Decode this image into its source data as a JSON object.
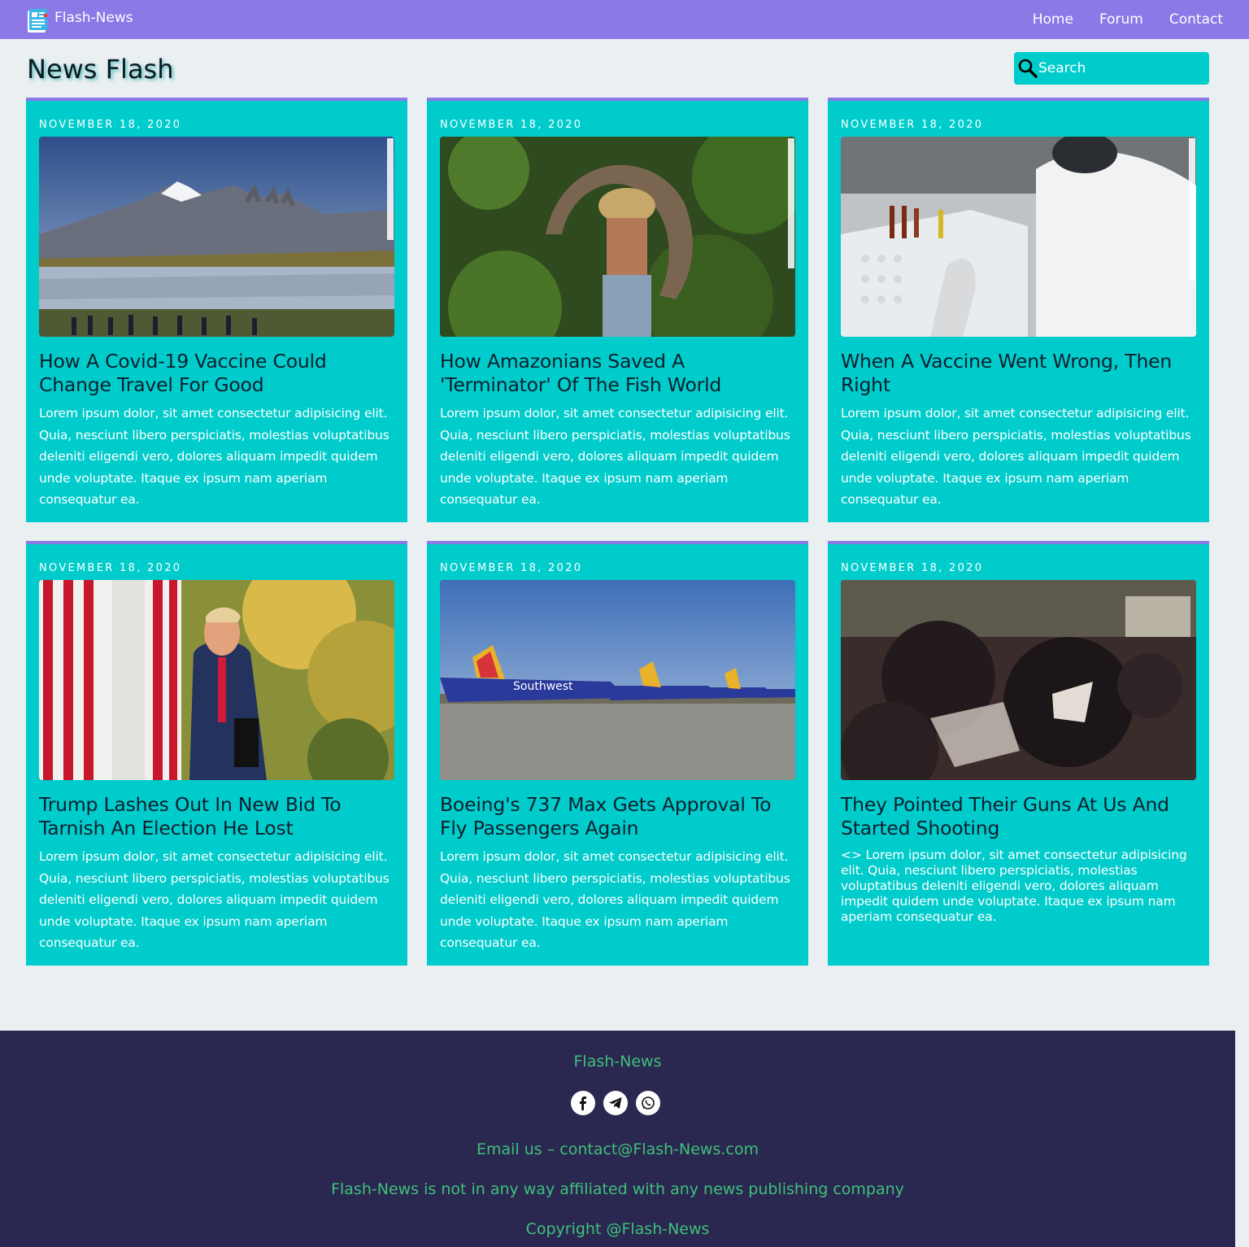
{
  "navbar": {
    "brand": "Flash-News",
    "links": [
      "Home",
      "Forum",
      "Contact"
    ]
  },
  "header": {
    "title": "News Flash",
    "search_placeholder": "Search"
  },
  "articles": [
    {
      "date": "NOVEMBER 18, 2020",
      "title": "How A Covid-19 Vaccine Could Change Travel For Good",
      "body": "Lorem ipsum dolor, sit amet consectetur adipisicing elit. Quia, nesciunt libero perspiciatis, molestias voluptatibus deleniti eligendi vero, dolores aliquam impedit quidem unde voluptate. Itaque ex ipsum nam aperiam consequatur ea.",
      "image": "mountain-lake-photo"
    },
    {
      "date": "NOVEMBER 18, 2020",
      "title": "How Amazonians Saved A 'Terminator' Of The Fish World",
      "body": "Lorem ipsum dolor, sit amet consectetur adipisicing elit. Quia, nesciunt libero perspiciatis, molestias voluptatibus deleniti eligendi vero, dolores aliquam impedit quidem unde voluptate. Itaque ex ipsum nam aperiam consequatur ea.",
      "image": "man-carrying-fish-photo"
    },
    {
      "date": "NOVEMBER 18, 2020",
      "title": "When A Vaccine Went Wrong, Then Right",
      "body": "Lorem ipsum dolor, sit amet consectetur adipisicing elit. Quia, nesciunt libero perspiciatis, molestias voluptatibus deleniti eligendi vero, dolores aliquam impedit quidem unde voluptate. Itaque ex ipsum nam aperiam consequatur ea.",
      "image": "lab-vials-photo"
    },
    {
      "date": "NOVEMBER 18, 2020",
      "title": "Trump Lashes Out In New Bid To Tarnish An Election He Lost",
      "body": "Lorem ipsum dolor, sit amet consectetur adipisicing elit. Quia, nesciunt libero perspiciatis, molestias voluptatibus deleniti eligendi vero, dolores aliquam impedit quidem unde voluptate. Itaque ex ipsum nam aperiam consequatur ea.",
      "image": "man-in-suit-photo"
    },
    {
      "date": "NOVEMBER 18, 2020",
      "title": "Boeing's 737 Max Gets Approval To Fly Passengers Again",
      "body": "Lorem ipsum dolor, sit amet consectetur adipisicing elit. Quia, nesciunt libero perspiciatis, molestias voluptatibus deleniti eligendi vero, dolores aliquam impedit quidem unde voluptate. Itaque ex ipsum nam aperiam consequatur ea.",
      "image": "parked-airplanes-photo"
    },
    {
      "date": "NOVEMBER 18, 2020",
      "title": "They Pointed Their Guns At Us And Started Shooting",
      "body": "<> Lorem ipsum dolor, sit amet consectetur adipisicing elit. Quia, nesciunt libero perspiciatis, molestias voluptatibus deleniti eligendi vero, dolores aliquam impedit quidem unde voluptate. Itaque ex ipsum nam aperiam consequatur ea.",
      "image": "dark-crowd-photo"
    }
  ],
  "footer": {
    "brand": "Flash-News",
    "social": [
      "facebook-icon",
      "telegram-icon",
      "whatsapp-icon"
    ],
    "email": "Email us – contact@Flash-News.com",
    "disclaimer": "Flash-News is not in any way affiliated with any news publishing company",
    "copyright": "Copyright @Flash-News"
  },
  "colors": {
    "navbar": "#8c78e6",
    "card": "#00cccc",
    "footer": "#2a2850",
    "footer_text": "#3fc07a",
    "background": "#eaeff2"
  }
}
